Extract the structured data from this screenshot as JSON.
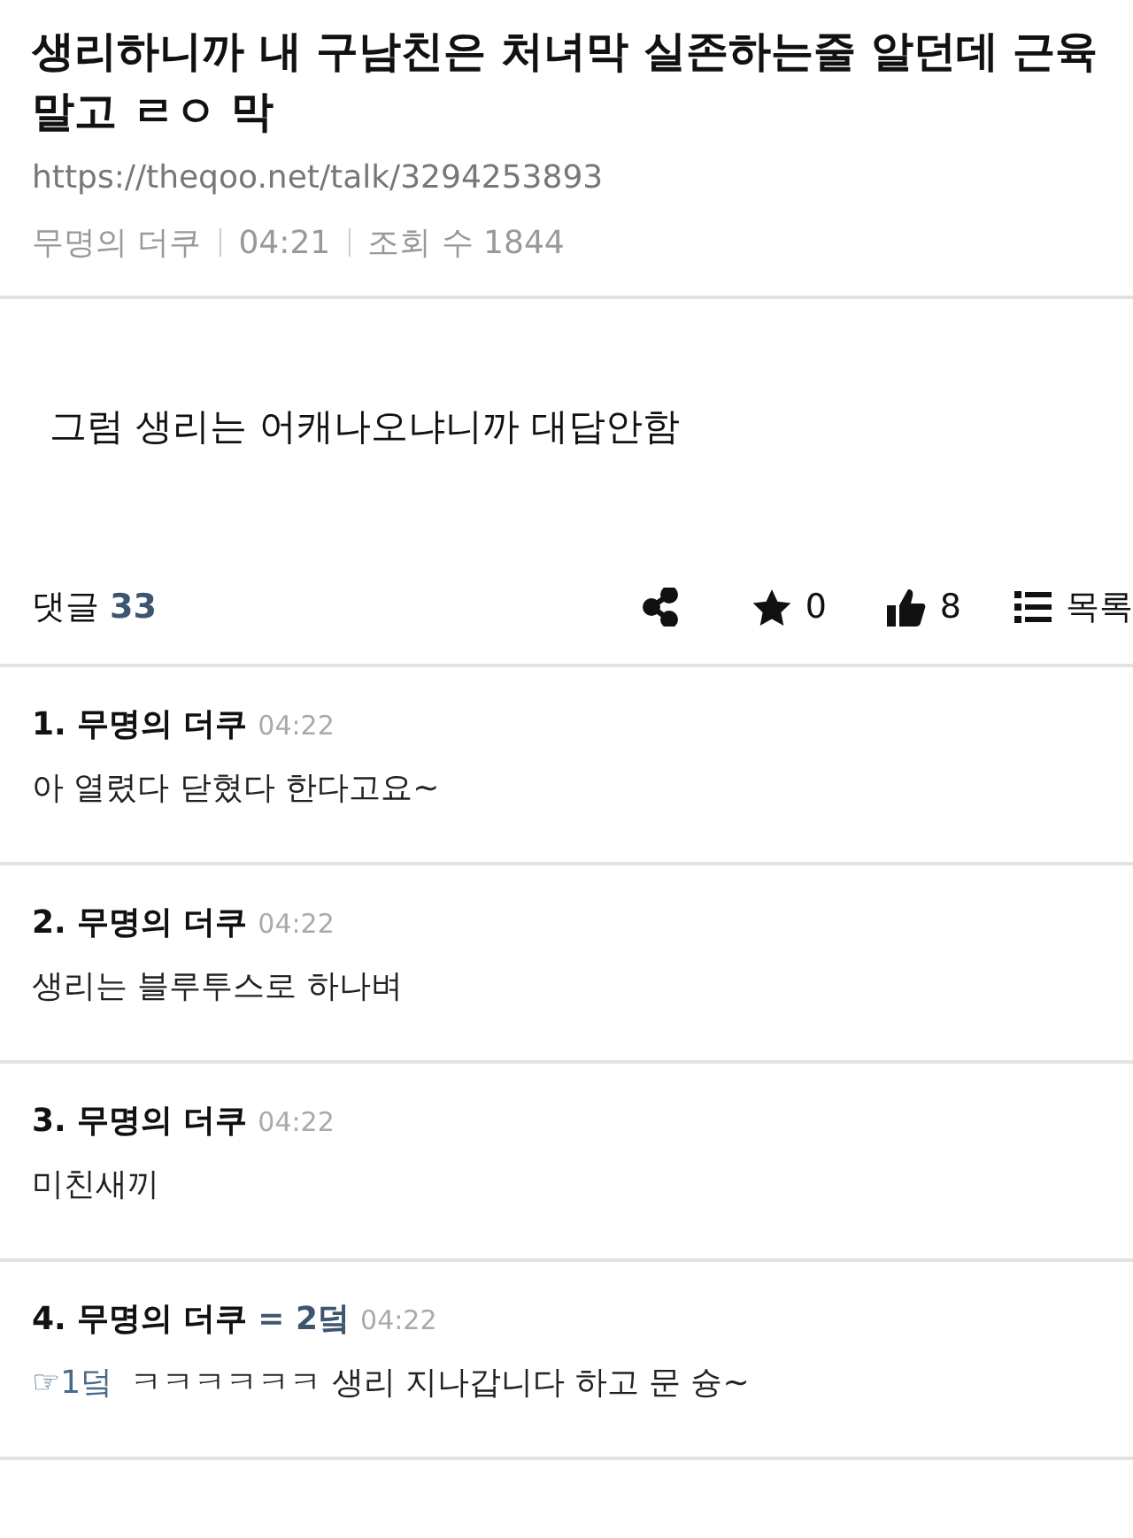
{
  "post": {
    "title": "생리하니까 내 구남친은 처녀막 실존하는줄 알던데 근육말고 ㄹㅇ 막",
    "url": "https://theqoo.net/talk/3294253893",
    "author": "무명의 더쿠",
    "time": "04:21",
    "views": "조회 수 1844",
    "body": "그럼 생리는 어캐나오냐니까 대답안함"
  },
  "toolbar": {
    "comments_label": "댓글",
    "comments_count": "33",
    "stars": "0",
    "likes": "8",
    "list_label": "목록"
  },
  "comments": [
    {
      "number": "1.",
      "author": "무명의 더쿠",
      "time": "04:22",
      "body": "아 열렸다 닫혔다 한다고요~"
    },
    {
      "number": "2.",
      "author": "무명의 더쿠",
      "time": "04:22",
      "body": "생리는 블루투스로 하나벼"
    },
    {
      "number": "3.",
      "author": "무명의 더쿠",
      "time": "04:22",
      "body": "미친새끼"
    },
    {
      "number": "4.",
      "author": "무명의 더쿠",
      "reply_to": "= 2덬",
      "time": "04:22",
      "reply_ref": "☞1덬",
      "body": "ㅋㅋㅋㅋㅋㅋ 생리 지나갑니다 하고 문 슝~"
    }
  ]
}
